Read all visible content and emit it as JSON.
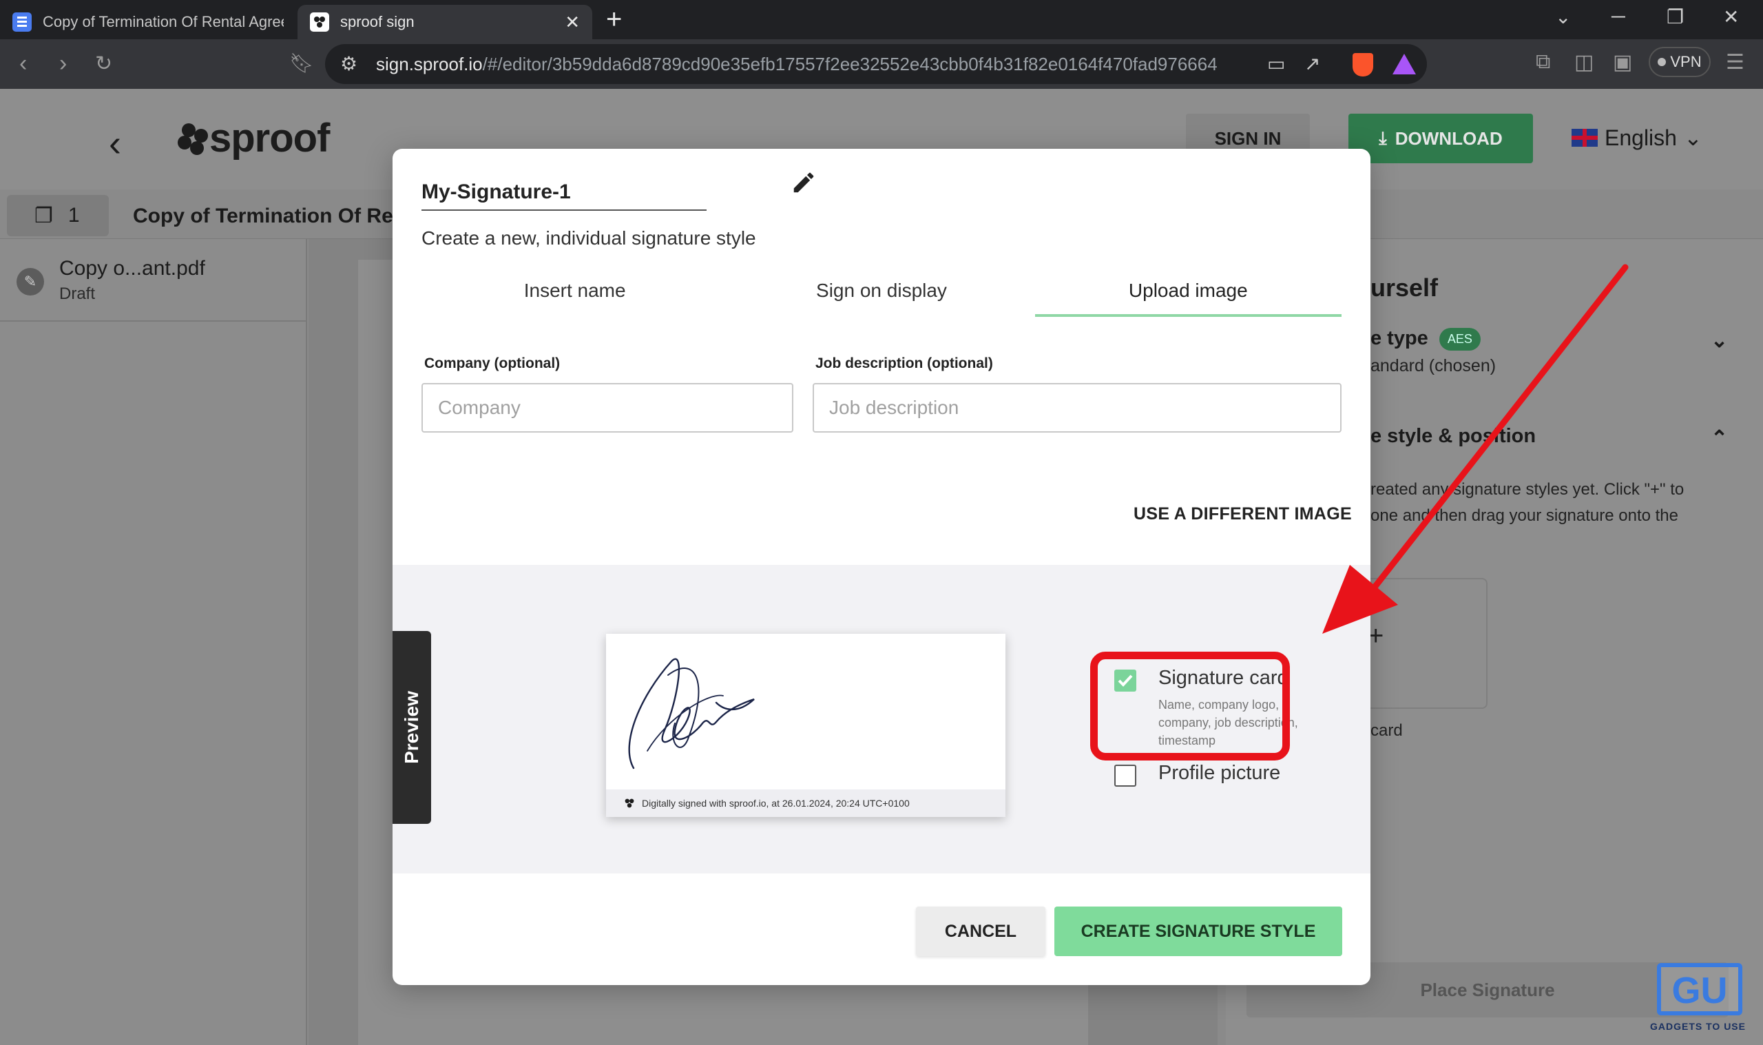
{
  "browser": {
    "tabs": [
      {
        "title": "Copy of Termination Of Rental Agreem",
        "favicon": "docs-icon"
      },
      {
        "title": "sproof sign",
        "favicon": "sproof-icon",
        "active": true
      }
    ],
    "url_domain": "sign.sproof.io",
    "url_path": "/#/editor/3b59dda6d8789cd90e35efb17557f2ee32552e43cbb0f4b31f82e0164f470fad976664",
    "badge_count": "2",
    "vpn_label": "VPN"
  },
  "app": {
    "logo_text": "sproof",
    "sign_in_label": "SIGN IN",
    "download_label": "DOWNLOAD",
    "language": "English",
    "page_count": "1",
    "document_title": "Copy of Termination Of Ren",
    "doc_item": {
      "name": "Copy o...ant.pdf",
      "status": "Draft"
    },
    "right_panel": {
      "heading1": "urself",
      "type_label": "e type",
      "type_badge": "AES",
      "type_value": "andard (chosen)",
      "style_heading": "e style & position",
      "info_line1": "reated any signature styles yet. Click \"+\" to",
      "info_line2": "one and then drag your signature onto the",
      "plus": "+",
      "card_label": "card",
      "place_signature": "Place Signature"
    }
  },
  "modal": {
    "signature_name": "My-Signature-1",
    "subtitle": "Create a new, individual signature style",
    "tabs": [
      {
        "label": "Insert name"
      },
      {
        "label": "Sign on display"
      },
      {
        "label": "Upload image",
        "active": true
      }
    ],
    "company": {
      "label": "Company (optional)",
      "placeholder": "Company",
      "value": ""
    },
    "job": {
      "label": "Job description (optional)",
      "placeholder": "Job description",
      "value": ""
    },
    "use_different_image": "USE A DIFFERENT IMAGE",
    "preview_label": "Preview",
    "signature_footer": "Digitally signed with sproof.io, at  26.01.2024, 20:24 UTC+0100",
    "options": [
      {
        "title": "Signature card",
        "description": "Name, company logo, company, job description, timestamp",
        "checked": true
      },
      {
        "title": "Profile picture",
        "checked": false
      }
    ],
    "cancel_label": "CANCEL",
    "create_label": "CREATE SIGNATURE STYLE"
  },
  "annotation": {
    "highlight_color": "#e8131a",
    "arrow_color": "#e8131a"
  },
  "watermark": {
    "text": "GADGETS TO USE"
  },
  "colors": {
    "accent_green": "#7fdb9b",
    "tab_underline": "#8fd7a5"
  }
}
